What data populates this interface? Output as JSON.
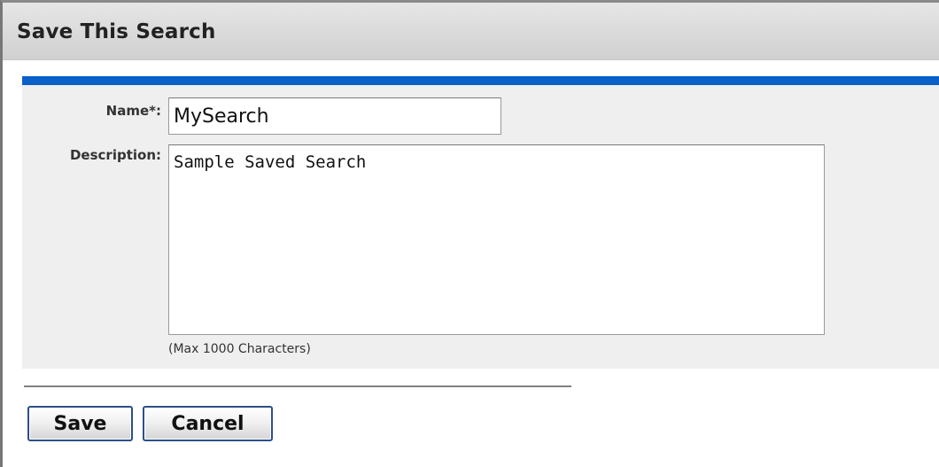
{
  "dialog": {
    "title": "Save This Search"
  },
  "form": {
    "name": {
      "label": "Name*:",
      "value": "MySearch"
    },
    "description": {
      "label": "Description:",
      "value": "Sample Saved Search",
      "hint": "(Max 1000 Characters)"
    }
  },
  "actions": {
    "save_label": "Save",
    "cancel_label": "Cancel"
  },
  "colors": {
    "accent": "#0a5fc9",
    "panel_background": "#efefef",
    "button_border": "#2e4f86"
  }
}
